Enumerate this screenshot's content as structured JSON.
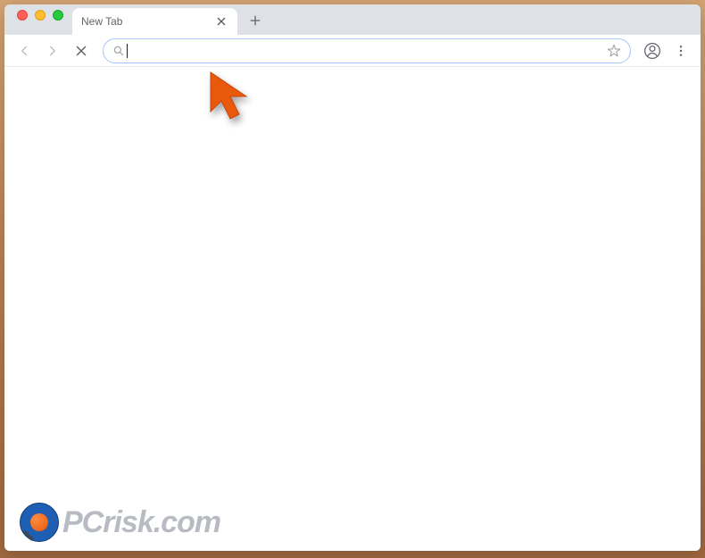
{
  "browser": {
    "tab": {
      "title": "New Tab"
    },
    "omnibox": {
      "value": "",
      "placeholder": ""
    }
  },
  "watermark": {
    "text_pc": "PC",
    "text_rest": "risk.com"
  },
  "icons": {
    "close": "close-icon",
    "new_tab": "plus-icon",
    "back": "back-arrow-icon",
    "forward": "forward-arrow-icon",
    "stop": "stop-icon",
    "search": "search-icon",
    "star": "star-icon",
    "profile": "profile-icon",
    "menu": "kebab-menu-icon"
  }
}
